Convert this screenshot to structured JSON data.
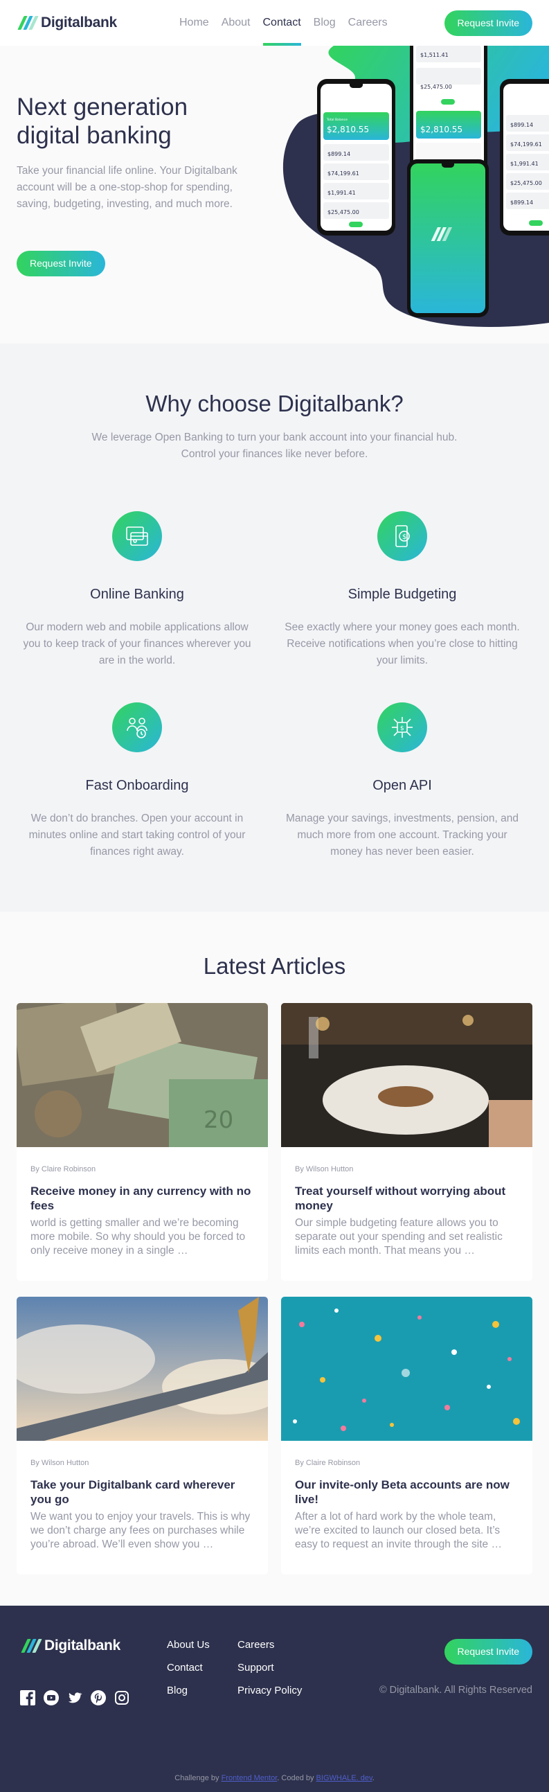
{
  "header": {
    "logo_text": "Digitalbank",
    "nav": [
      "Home",
      "About",
      "Contact",
      "Blog",
      "Careers"
    ],
    "active_nav": "Contact",
    "cta": "Request Invite"
  },
  "hero": {
    "title": "Next generation\ndigital banking",
    "description": "Take your financial life online. Your Digitalbank account will be a one-stop-shop for spending, saving, budgeting, investing, and much more.",
    "cta": "Request Invite",
    "phones": {
      "total_label": "Total Balance",
      "balance": "$2,810.55",
      "tx": [
        "$899.14",
        "$74,199.61",
        "$1,991.41",
        "$25,475.00",
        "$899.14"
      ],
      "tx_top": [
        "$1,511.41",
        "$25,475.00"
      ]
    }
  },
  "why": {
    "title": "Why choose Digitalbank?",
    "subtitle": "We leverage Open Banking to turn your bank account into your financial hub.\nControl your finances like never before.",
    "features": [
      {
        "title": "Online Banking",
        "icon": "online-banking-icon",
        "description": "Our modern web and mobile applications allow you to keep track of your finances wherever you are in the world."
      },
      {
        "title": "Simple Budgeting",
        "icon": "budgeting-icon",
        "description": "See exactly where your money goes each month. Receive notifications when you’re close to hitting your limits."
      },
      {
        "title": "Fast Onboarding",
        "icon": "onboarding-icon",
        "description": "We don’t do branches. Open your account in minutes online and start taking control of your finances right away."
      },
      {
        "title": "Open API",
        "icon": "api-icon",
        "description": "Manage your savings, investments, pension, and much more from one account. Tracking your money has never been easier."
      }
    ]
  },
  "articles": {
    "title": "Latest Articles",
    "items": [
      {
        "author": "By Claire Robinson",
        "title": "Receive money in any currency with no fees",
        "excerpt": "world is getting smaller and we’re becoming more mobile. So why should you be forced to only receive money in a single …"
      },
      {
        "author": "By Wilson Hutton",
        "title": "Treat yourself without worrying about money",
        "excerpt": "Our simple budgeting feature allows you to separate out your spending and set realistic limits each month. That means you …"
      },
      {
        "author": "By Wilson Hutton",
        "title": "Take your Digitalbank card wherever you go",
        "excerpt": "We want you to enjoy your travels. This is why we don’t charge any fees on purchases while you’re abroad. We’ll even show you …"
      },
      {
        "author": "By Claire Robinson",
        "title": "Our invite-only Beta accounts are now live!",
        "excerpt": "After a lot of hard work by the whole team, we’re excited to launch our closed beta. It’s easy to request an invite through the site …"
      }
    ]
  },
  "footer": {
    "logo_text": "Digitalbank",
    "col1": [
      "About Us",
      "Contact",
      "Blog"
    ],
    "col2": [
      "Careers",
      "Support",
      "Privacy Policy"
    ],
    "cta": "Request Invite",
    "copyright": "© Digitalbank. All Rights Reserved",
    "socials": [
      "facebook-icon",
      "youtube-icon",
      "twitter-icon",
      "pinterest-icon",
      "instagram-icon"
    ]
  },
  "attribution": {
    "prefix": "Challenge by",
    "mentor": "Frontend Mentor",
    "middle": ". Coded by",
    "coder": "BIGWHALE. dev",
    "suffix": "."
  },
  "colors": {
    "navy": "#2d314d",
    "green": "#33d35e",
    "cyan": "#2ab6d9",
    "gray": "#9698a6",
    "light": "#f3f4f6"
  }
}
